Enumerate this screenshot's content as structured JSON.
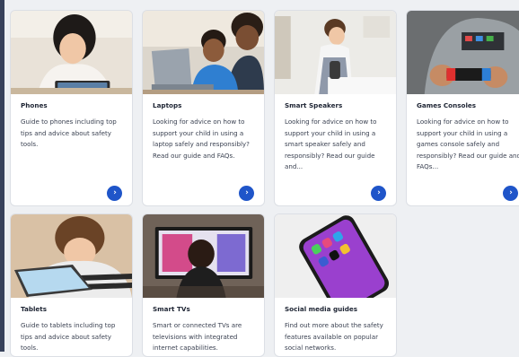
{
  "cards": [
    {
      "title": "Phones",
      "description": "Guide to phones including top tips and advice about safety tools.",
      "button_icon": "chevron-right-icon",
      "has_button": true
    },
    {
      "title": "Laptops",
      "description": "Looking for advice on how to support your child in using a laptop safely and responsibly? Read our guide and FAQs.",
      "button_icon": "chevron-right-icon",
      "has_button": true
    },
    {
      "title": "Smart Speakers",
      "description": "Looking for advice on how to support your child in using a smart speaker safely and responsibly? Read our guide and...",
      "button_icon": "chevron-right-icon",
      "has_button": true
    },
    {
      "title": "Games Consoles",
      "description": "Looking for advice on how to support your child in using a games console safely and responsibly? Read our guide and FAQs...",
      "button_icon": "chevron-right-icon",
      "has_button": true
    },
    {
      "title": "Tablets",
      "description": "Guide to tablets including top tips and advice about safety tools."
    },
    {
      "title": "Smart TVs",
      "description": "Smart or connected TVs are televisions with integrated internet capabilities."
    },
    {
      "title": "Social media guides",
      "description": "Find out more about the safety features available on popular social networks."
    }
  ],
  "colors": {
    "accent": "#1f55c9",
    "sidebar": "#37415a",
    "card_border": "#dcdfe5",
    "page_bg": "#eef0f3"
  },
  "button_glyph": "›"
}
